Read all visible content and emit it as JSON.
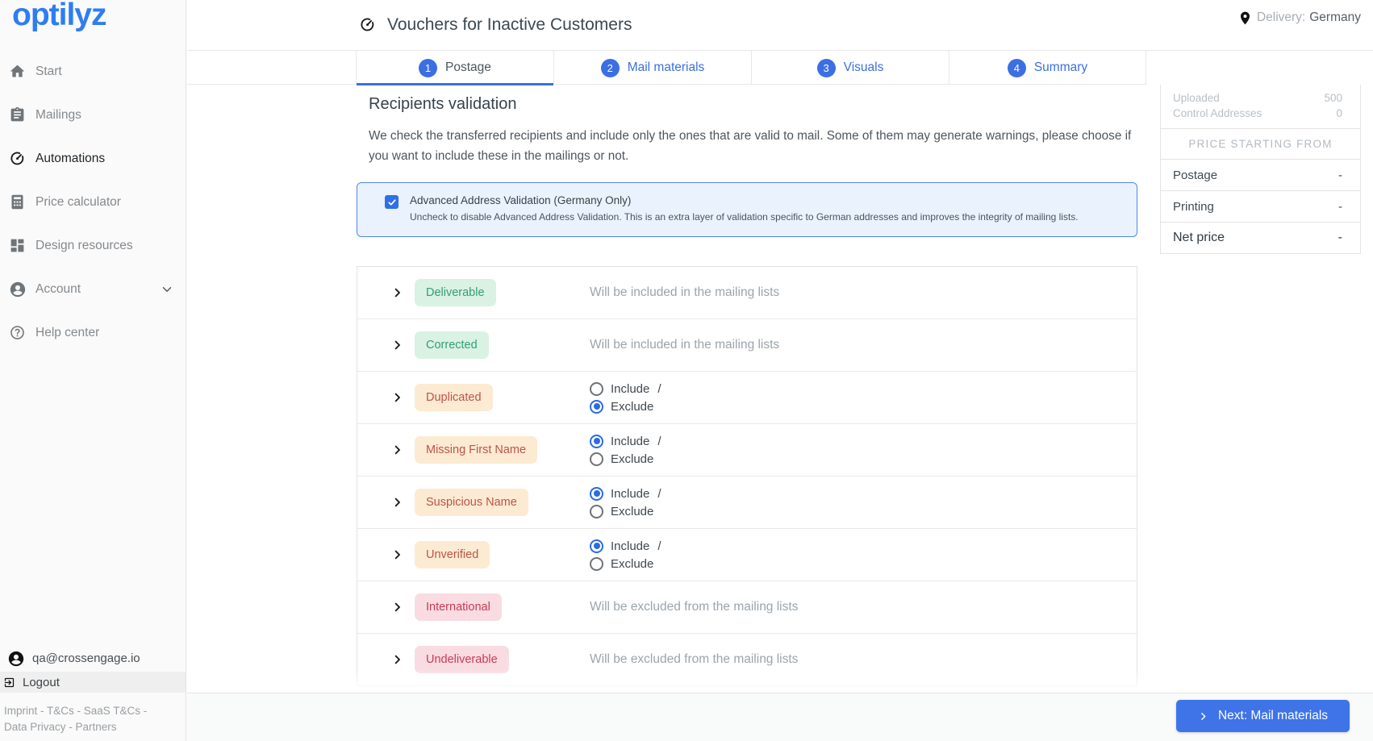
{
  "brand": {
    "logo_text": "optilyz"
  },
  "sidebar": {
    "items": [
      {
        "icon": "home-icon",
        "label": "Start",
        "active": false,
        "expandable": false
      },
      {
        "icon": "mailings-icon",
        "label": "Mailings",
        "active": false,
        "expandable": false
      },
      {
        "icon": "automations-icon",
        "label": "Automations",
        "active": true,
        "expandable": false
      },
      {
        "icon": "calculator-icon",
        "label": "Price calculator",
        "active": false,
        "expandable": false
      },
      {
        "icon": "design-resources-icon",
        "label": "Design resources",
        "active": false,
        "expandable": false
      },
      {
        "icon": "account-icon",
        "label": "Account",
        "active": false,
        "expandable": true
      },
      {
        "icon": "help-icon",
        "label": "Help center",
        "active": false,
        "expandable": false
      }
    ],
    "user_email": "qa@crossengage.io",
    "logout_label": "Logout",
    "legal_line1": "Imprint - T&Cs - SaaS T&Cs -",
    "legal_line2": "Data Privacy - Partners"
  },
  "header": {
    "title": "Vouchers for Inactive Customers",
    "delivery_label": "Delivery:",
    "delivery_value": "Germany"
  },
  "tabs": [
    {
      "number": "1",
      "label": "Postage",
      "active": true
    },
    {
      "number": "2",
      "label": "Mail materials",
      "active": false
    },
    {
      "number": "3",
      "label": "Visuals",
      "active": false
    },
    {
      "number": "4",
      "label": "Summary",
      "active": false
    }
  ],
  "summary_panel": {
    "stats": [
      {
        "label": "Uploaded",
        "value": "500"
      },
      {
        "label": "Control Addresses",
        "value": "0"
      }
    ],
    "price_header": "PRICE STARTING FROM",
    "price_rows": [
      {
        "label": "Postage",
        "value": "-",
        "emphasis": false
      },
      {
        "label": "Printing",
        "value": "-",
        "emphasis": false
      },
      {
        "label": "Net price",
        "value": "-",
        "emphasis": true
      }
    ]
  },
  "main": {
    "heading": "Recipients validation",
    "intro": "We check the transferred recipients and include only the ones that are valid to mail. Some of them may generate warnings, please choose if you want to include these in the mailings or not.",
    "advanced_validation": {
      "checked": true,
      "label": "Advanced Address Validation (Germany Only)",
      "description": "Uncheck to disable Advanced Address Validation. This is an extra layer of validation specific to German addresses and improves the integrity of mailing lists."
    },
    "radio": {
      "include_label": "Include",
      "exclude_label": "Exclude",
      "separator": "/"
    },
    "categories": [
      {
        "label": "Deliverable",
        "type": "success",
        "status": "Will be included in the mailing lists"
      },
      {
        "label": "Corrected",
        "type": "success",
        "status": "Will be included in the mailing lists"
      },
      {
        "label": "Duplicated",
        "type": "warning",
        "choice": "exclude"
      },
      {
        "label": "Missing First Name",
        "type": "warning",
        "choice": "include"
      },
      {
        "label": "Suspicious Name",
        "type": "warning",
        "choice": "include"
      },
      {
        "label": "Unverified",
        "type": "warning",
        "choice": "include"
      },
      {
        "label": "International",
        "type": "error",
        "status": "Will be excluded from the mailing lists"
      },
      {
        "label": "Undeliverable",
        "type": "error",
        "status": "Will be excluded from the mailing lists"
      }
    ]
  },
  "footer": {
    "next_button": "Next: Mail materials"
  },
  "colors": {
    "accent_blue": "#3b6fe3",
    "logo_blue": "#2e7df2",
    "success_badge_bg": "#d9f2e3",
    "success_badge_text": "#349e72",
    "warning_badge_bg": "#fdead2",
    "warning_badge_text": "#bb5549",
    "error_badge_bg": "#f9dce2",
    "error_badge_text": "#ca3a55",
    "sidebar_bg": "#fafafa",
    "footer_bg": "#f9fafa"
  }
}
